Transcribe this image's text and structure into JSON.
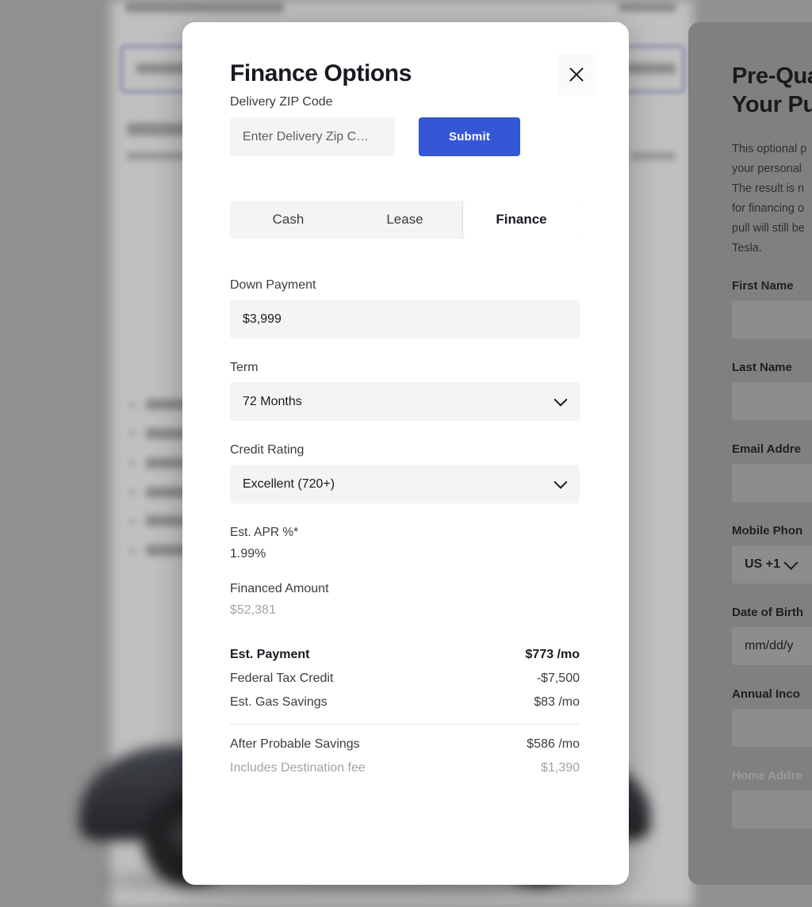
{
  "modal": {
    "title": "Finance Options",
    "close_label": "Close",
    "close_icon": "close-icon",
    "zip": {
      "label": "Delivery ZIP Code",
      "placeholder": "Enter Delivery Zip C…",
      "value": "",
      "submit_label": "Submit"
    },
    "tabs": [
      {
        "label": "Cash",
        "active": false
      },
      {
        "label": "Lease",
        "active": false
      },
      {
        "label": "Finance",
        "active": true
      }
    ],
    "down_payment": {
      "label": "Down Payment",
      "value": "$3,999"
    },
    "term": {
      "label": "Term",
      "value": "72 Months",
      "icon": "chevron-down-icon"
    },
    "credit_rating": {
      "label": "Credit Rating",
      "value": "Excellent (720+)",
      "icon": "chevron-down-icon"
    },
    "apr": {
      "label": "Est. APR %*",
      "value": "1.99%"
    },
    "financed_amount": {
      "label": "Financed Amount",
      "value": "$52,381"
    },
    "summary": [
      {
        "label": "Est. Payment",
        "value": "$773 /mo",
        "style": "bold"
      },
      {
        "label": "Federal Tax Credit",
        "value": "-$7,500",
        "style": "normal"
      },
      {
        "label": "Est. Gas Savings",
        "value": "$83 /mo",
        "style": "normal"
      }
    ],
    "summary_after": [
      {
        "label": "After Probable Savings",
        "value": "$586 /mo",
        "style": "normal"
      },
      {
        "label": "Includes Destination fee",
        "value": "$1,390",
        "style": "muted"
      }
    ]
  },
  "prequalify": {
    "title": "Pre-Qua\nYour Pu",
    "blurb": "This optional p\nyour personal\nThe result is n\nfor financing o\npull will still be\nTesla.",
    "fields": [
      {
        "label": "First Name",
        "value": "",
        "muted": false
      },
      {
        "label": "Last Name",
        "value": "",
        "muted": false
      },
      {
        "label": "Email Addre",
        "value": "",
        "muted": false
      },
      {
        "label": "Mobile Phon",
        "value": "US +1",
        "muted": false,
        "is_country": true
      },
      {
        "label": "Date of Birth",
        "value": "mm/dd/y",
        "muted": false
      },
      {
        "label": "Annual Inco",
        "value": "",
        "muted": false
      },
      {
        "label": "Home Addre",
        "value": "",
        "muted": true
      }
    ]
  },
  "colors": {
    "accent_blue": "#3457d5",
    "modal_bg": "#ffffff",
    "field_bg": "#f4f4f4",
    "text_primary": "#171a20",
    "text_secondary": "#393c41",
    "text_muted": "#a2a3a5",
    "backdrop": "#b6b6b6",
    "panel_dim": "#808080"
  }
}
